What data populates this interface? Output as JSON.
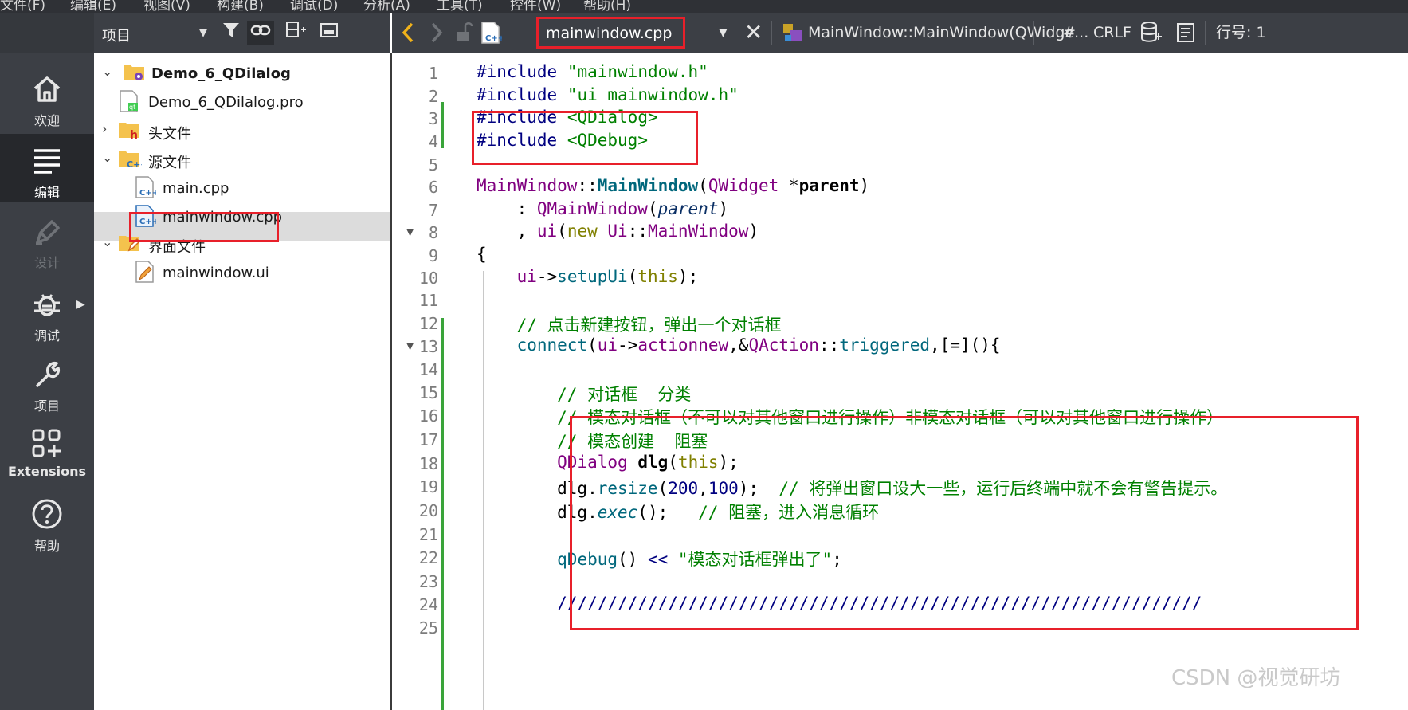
{
  "menubar": [
    "文件(F)",
    "编辑(E)",
    "视图(V)",
    "构建(B)",
    "调试(D)",
    "分析(A)",
    "工具(T)",
    "控件(W)",
    "帮助(H)"
  ],
  "modes": [
    {
      "label": "欢迎",
      "icon": "home-icon",
      "active": false,
      "enabled": true
    },
    {
      "label": "编辑",
      "icon": "edit-lines-icon",
      "active": true,
      "enabled": true
    },
    {
      "label": "设计",
      "icon": "pen-icon",
      "active": false,
      "enabled": false
    },
    {
      "label": "调试",
      "icon": "bug-icon",
      "active": false,
      "enabled": true
    },
    {
      "label": "项目",
      "icon": "wrench-icon",
      "active": false,
      "enabled": true
    },
    {
      "label": "Extensions",
      "icon": "extensions-grid-icon",
      "active": false,
      "enabled": true
    },
    {
      "label": "帮助",
      "icon": "help-icon",
      "active": false,
      "enabled": true
    }
  ],
  "project_panel": {
    "title": "项目",
    "tree": [
      {
        "label": "Demo_6_QDilalog",
        "depth": 0,
        "icon": "project-folder-icon",
        "expanded": true
      },
      {
        "label": "Demo_6_QDilalog.pro",
        "depth": 1,
        "icon": "pro-file-icon"
      },
      {
        "label": "头文件",
        "depth": 1,
        "icon": "header-folder-icon",
        "expanded": false
      },
      {
        "label": "源文件",
        "depth": 1,
        "icon": "source-folder-icon",
        "expanded": true
      },
      {
        "label": "main.cpp",
        "depth": 2,
        "icon": "cpp-file-icon"
      },
      {
        "label": "mainwindow.cpp",
        "depth": 2,
        "icon": "cpp-file-icon",
        "selected": true
      },
      {
        "label": "界面文件",
        "depth": 1,
        "icon": "forms-folder-icon",
        "expanded": true
      },
      {
        "label": "mainwindow.ui",
        "depth": 2,
        "icon": "ui-file-icon"
      }
    ]
  },
  "editor_toolbar": {
    "file": "mainwindow.cpp",
    "symbol": "MainWindow::MainWindow(QWidge...",
    "hash": "#",
    "line_ending": "CRLF",
    "position_label": "行号: 1"
  },
  "code_lines": [
    {
      "n": "1",
      "html": "<span class=\"pp\">#include</span> <span class=\"str\">\"mainwindow.h\"</span>"
    },
    {
      "n": "2",
      "html": "<span class=\"pp\">#include</span> <span class=\"str\">\"ui_mainwindow.h\"</span>"
    },
    {
      "n": "3",
      "html": "<span class=\"pp\">#include</span> <span class=\"inc\">&lt;QDialog&gt;</span>"
    },
    {
      "n": "4",
      "html": "<span class=\"pp\">#include</span> <span class=\"inc\">&lt;QDebug&gt;</span>"
    },
    {
      "n": "5",
      "html": ""
    },
    {
      "n": "6",
      "html": "<span class=\"ty\">MainWindow</span>::<span class=\"fn bold\">MainWindow</span>(<span class=\"ty\">QWidget</span> *<span class=\"bold\">parent</span>)"
    },
    {
      "n": "7",
      "html": "    : <span class=\"ty\">QMainWindow</span>(<span class=\"it-par\">parent</span>)"
    },
    {
      "n": "8",
      "html": "    , <span class=\"ty\">ui</span>(<span class=\"kw\">new</span> <span class=\"ty\">Ui</span>::<span class=\"ty\">MainWindow</span>)"
    },
    {
      "n": "9",
      "html": "{"
    },
    {
      "n": "10",
      "html": "    <span class=\"ty\">ui</span>-&gt;<span class=\"fn\">setupUi</span>(<span class=\"kw\">this</span>);"
    },
    {
      "n": "11",
      "html": ""
    },
    {
      "n": "12",
      "html": "    <span class=\"com\">// 点击新建按钮，弹出一个对话框</span>"
    },
    {
      "n": "13",
      "html": "    <span class=\"fn\">connect</span>(<span class=\"ty\">ui</span>-&gt;<span class=\"ty\">actionnew</span>,&amp;<span class=\"ty\">QAction</span>::<span class=\"fn\">triggered</span>,[=](){"
    },
    {
      "n": "14",
      "html": ""
    },
    {
      "n": "15",
      "html": "        <span class=\"com\">// 对话框  分类</span>"
    },
    {
      "n": "16",
      "html": "        <span class=\"com\">// 模态对话框（不可以对其他窗口进行操作）非模态对话框（可以对其他窗口进行操作）</span>"
    },
    {
      "n": "17",
      "html": "        <span class=\"com\">// 模态创建  阻塞</span>"
    },
    {
      "n": "18",
      "html": "        <span class=\"ty\">QDialog</span> <span class=\"bold\">dlg</span>(<span class=\"kw\">this</span>);"
    },
    {
      "n": "19",
      "html": "        dlg.<span class=\"fn\">resize</span>(<span class=\"num\">200</span>,<span class=\"num\">100</span>);  <span class=\"com\">// 将弹出窗口设大一些，运行后终端中就不会有警告提示。</span>"
    },
    {
      "n": "20",
      "html": "        dlg.<span class=\"fn\" style=\"font-style:italic\">exec</span>();   <span class=\"com\">// 阻塞，进入消息循环</span>"
    },
    {
      "n": "21",
      "html": ""
    },
    {
      "n": "22",
      "html": "        <span class=\"fn\">qDebug</span>() <span class=\"pp\">&lt;&lt;</span> <span class=\"str\">\"模态对话框弹出了\"</span>;"
    },
    {
      "n": "23",
      "html": ""
    },
    {
      "n": "24",
      "html": "        <span class=\"pp\">////////////////////////////////////////////////////////////////</span>"
    },
    {
      "n": "25",
      "html": ""
    }
  ],
  "watermark": "CSDN @视觉研坊"
}
